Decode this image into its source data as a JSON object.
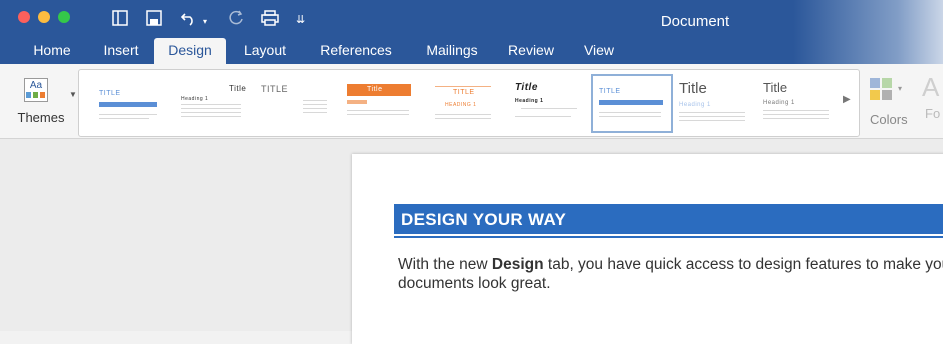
{
  "window": {
    "title": "Document"
  },
  "colors": {
    "brand": "#2b579a",
    "accent": "#2b6cbf"
  },
  "toolbar": {
    "icons": [
      "layout-icon",
      "save-icon",
      "undo-icon",
      "redo-icon",
      "print-icon",
      "customize-icon"
    ]
  },
  "tabs": [
    {
      "label": "Home"
    },
    {
      "label": "Insert"
    },
    {
      "label": "Design"
    },
    {
      "label": "Layout"
    },
    {
      "label": "References"
    },
    {
      "label": "Mailings"
    },
    {
      "label": "Review"
    },
    {
      "label": "View"
    }
  ],
  "active_tab": "Design",
  "ribbon": {
    "themes_label": "Themes",
    "colors_label": "Colors",
    "fonts_label_partial": "Fo",
    "styles": [
      {
        "title": "TITLE"
      },
      {
        "title": "Title",
        "heading": "Heading 1"
      },
      {
        "title": "TITLE"
      },
      {
        "title": "Title"
      },
      {
        "title": "TITLE",
        "heading": "HEADING 1"
      },
      {
        "title": "Title",
        "heading": "Heading 1"
      },
      {
        "title": "TITLE"
      },
      {
        "title": "Title",
        "heading": "Heading 1"
      },
      {
        "title": "Title",
        "heading": "Heading 1"
      }
    ]
  },
  "document": {
    "heading": "DESIGN YOUR WAY",
    "body_before": "With the new ",
    "body_bold": "Design",
    "body_after": " tab, you have quick access to design features to make your documents look great."
  }
}
